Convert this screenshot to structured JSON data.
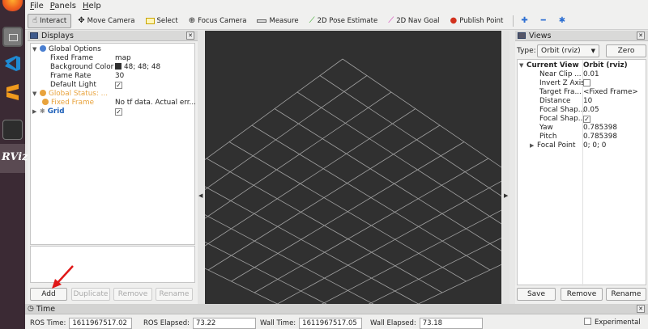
{
  "menu": {
    "file": "File",
    "panels": "Panels",
    "help": "Help"
  },
  "toolbar": {
    "interact": "Interact",
    "move_camera": "Move Camera",
    "select": "Select",
    "focus_camera": "Focus Camera",
    "measure": "Measure",
    "pose_estimate": "2D Pose Estimate",
    "nav_goal": "2D Nav Goal",
    "publish_point": "Publish Point"
  },
  "displays": {
    "title": "Displays",
    "rows": {
      "global_options": "Global Options",
      "fixed_frame_k": "Fixed Frame",
      "fixed_frame_v": "map",
      "bg_color_k": "Background Color",
      "bg_color_v": "48; 48; 48",
      "frame_rate_k": "Frame Rate",
      "frame_rate_v": "30",
      "default_light_k": "Default Light",
      "global_status": "Global Status: ...",
      "status_fixed_frame_k": "Fixed Frame",
      "status_fixed_frame_v": "No tf data.  Actual err...",
      "grid": "Grid"
    },
    "buttons": {
      "add": "Add",
      "duplicate": "Duplicate",
      "remove": "Remove",
      "rename": "Rename"
    }
  },
  "views": {
    "title": "Views",
    "type_label": "Type:",
    "type_value": "Orbit (rviz)",
    "zero": "Zero",
    "current_view_k": "Current View",
    "current_view_v": "Orbit (rviz)",
    "rows": [
      {
        "k": "Near Clip ...",
        "v": "0.01"
      },
      {
        "k": "Invert Z Axis",
        "v": ""
      },
      {
        "k": "Target Fra...",
        "v": "<Fixed Frame>"
      },
      {
        "k": "Distance",
        "v": "10"
      },
      {
        "k": "Focal Shap...",
        "v": "0.05"
      },
      {
        "k": "Focal Shap...",
        "v": "✓"
      },
      {
        "k": "Yaw",
        "v": "0.785398"
      },
      {
        "k": "Pitch",
        "v": "0.785398"
      }
    ],
    "focal_point_k": "Focal Point",
    "focal_point_v": "0; 0; 0",
    "buttons": {
      "save": "Save",
      "remove": "Remove",
      "rename": "Rename"
    }
  },
  "time": {
    "title": "Time",
    "ros_time_label": "ROS Time:",
    "ros_time": "1611967517.02",
    "ros_elapsed_label": "ROS Elapsed:",
    "ros_elapsed": "73.22",
    "wall_time_label": "Wall Time:",
    "wall_time": "1611967517.05",
    "wall_elapsed_label": "Wall Elapsed:",
    "wall_elapsed": "73.18",
    "experimental": "Experimental"
  },
  "colors": {
    "background": "#303030",
    "grid": "#a0a0a0",
    "warning": "#e8a33d",
    "link": "#1c5fb8"
  }
}
